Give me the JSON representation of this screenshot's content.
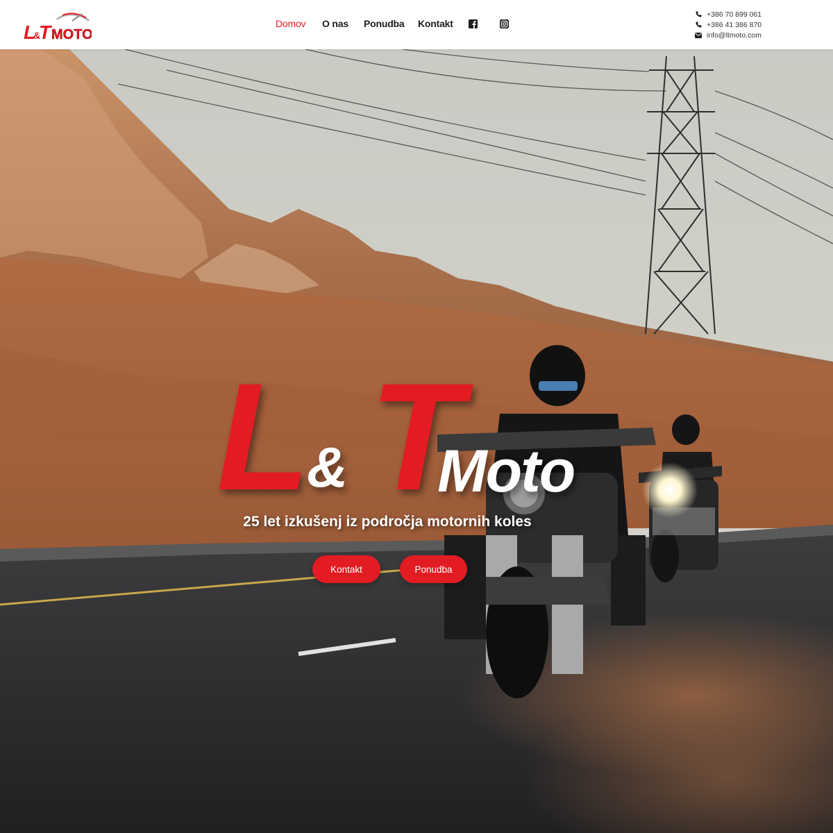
{
  "brand": {
    "logo_text_l": "L",
    "logo_text_amp": "&",
    "logo_text_t": "T",
    "logo_text_moto": "MOTO",
    "accent_color": "#e31b23"
  },
  "nav": {
    "items": [
      {
        "label": "Domov",
        "active": true
      },
      {
        "label": "O nas",
        "active": false
      },
      {
        "label": "Ponudba",
        "active": false
      },
      {
        "label": "Kontakt",
        "active": false
      }
    ],
    "social": [
      {
        "icon": "facebook-icon"
      },
      {
        "icon": "instagram-icon"
      }
    ]
  },
  "contact": {
    "phone1": "+386 70 899 061",
    "phone2": "+386 41 386 870",
    "email": "info@ltmoto.com",
    "icons": [
      "phone-icon",
      "phone-icon",
      "envelope-icon"
    ]
  },
  "hero": {
    "title_l": "L",
    "title_amp": "&",
    "title_t": "T",
    "title_moto": "Moto",
    "tagline": "25 let izkušenj iz področja motornih koles",
    "buttons": {
      "kontakt": "Kontakt",
      "ponudba": "Ponudba"
    }
  }
}
